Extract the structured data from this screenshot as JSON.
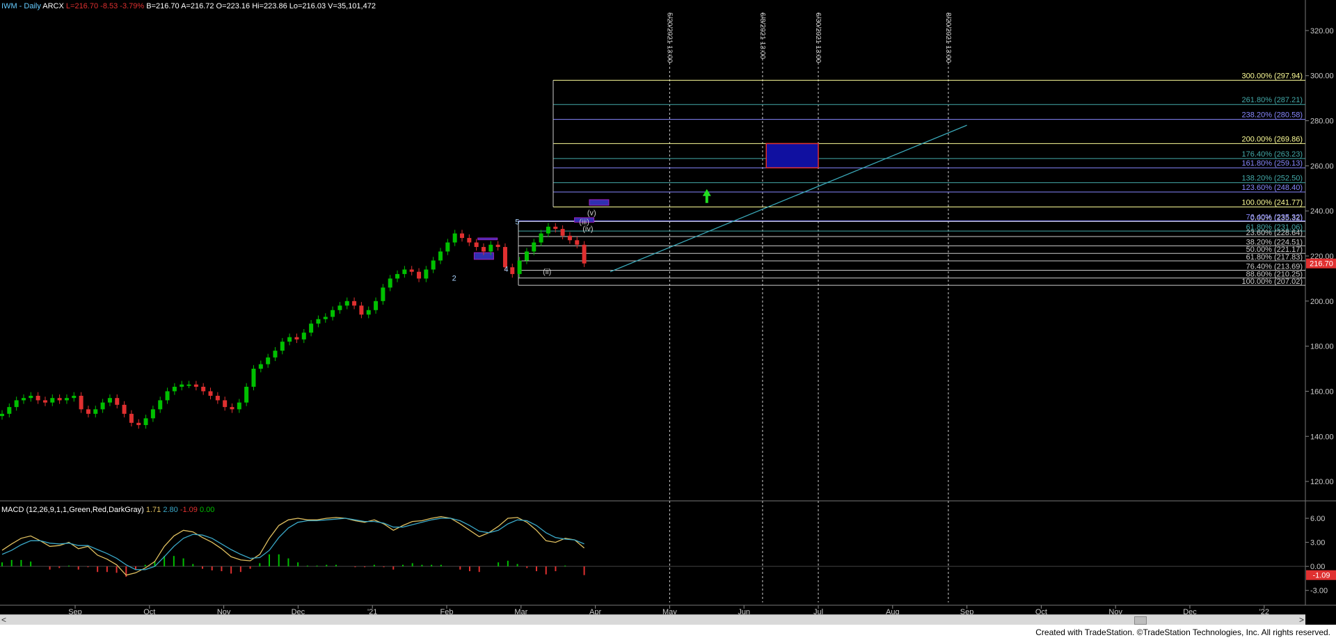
{
  "header": {
    "symbol": "IWM - Daily",
    "exchange": "ARCX",
    "last": "L=216.70",
    "change": "-8.53",
    "pct": "-3.79%",
    "bid": "B=216.70",
    "ask": "A=216.72",
    "open": "O=223.16",
    "high": "Hi=223.86",
    "low": "Lo=216.03",
    "volume": "V=35,101,472"
  },
  "macd_header": {
    "label": "MACD (12,26,9,1,1,Green,Red,DarkGray)",
    "v1": "1.71",
    "v2": "2.80",
    "v3": "-1.09",
    "v4": "0.00"
  },
  "colors": {
    "background": "#000000",
    "up_candle": "#00c000",
    "down_candle": "#e03030",
    "fib_yellow": "#ffff99",
    "fib_teal": "#44aaaa",
    "fib_blue": "#8888ff",
    "fib_white": "#cccccc",
    "target_box": "#1010a0",
    "trend_line": "#3aa8b8",
    "macd_line": "#3aa8c8",
    "signal_line": "#e0c060"
  },
  "footer": "Created with TradeStation. ©TradeStation Technologies, Inc. All rights reserved.",
  "chart_data": {
    "type": "candlestick",
    "price_axis": {
      "ylim": [
        112,
        328
      ],
      "ticks": [
        "320.00",
        "300.00",
        "280.00",
        "260.00",
        "240.00",
        "220.00",
        "200.00",
        "180.00",
        "160.00",
        "140.00",
        "120.00"
      ]
    },
    "current_price_label": "216.70",
    "macd_axis": {
      "ylim": [
        -4.5,
        8
      ],
      "ticks": [
        "6.00",
        "3.00",
        "0.00",
        "-3.00"
      ],
      "current_label": "-1.09"
    },
    "months": [
      "Sep",
      "Oct",
      "Nov",
      "Dec",
      "'21",
      "Feb",
      "Mar",
      "Apr",
      "May",
      "Jun",
      "Jul",
      "Aug",
      "Sep",
      "Oct",
      "Nov",
      "Dec",
      "'22"
    ],
    "close_path": [
      150,
      153,
      156,
      157,
      158,
      156,
      155,
      157,
      156,
      157,
      158,
      152,
      150,
      152,
      155,
      157,
      154,
      150,
      146,
      145,
      148,
      152,
      156,
      160,
      162,
      163,
      163,
      162,
      160,
      158,
      156,
      153,
      152,
      155,
      162,
      170,
      172,
      175,
      178,
      182,
      184,
      183,
      186,
      190,
      192,
      193,
      196,
      198,
      200,
      198,
      194,
      196,
      200,
      206,
      210,
      212,
      214,
      213,
      210,
      214,
      218,
      222,
      226,
      230,
      228,
      226,
      224,
      222,
      225,
      224,
      215,
      212,
      218,
      222,
      226,
      230,
      233,
      232,
      229,
      227,
      225,
      216.7
    ],
    "fib_levels_up": [
      {
        "label": "300.00% (297.94)",
        "value": 297.94,
        "color": "#ffff99"
      },
      {
        "label": "261.80% (287.21)",
        "value": 287.21,
        "color": "#44aaaa"
      },
      {
        "label": "238.20% (280.58)",
        "value": 280.58,
        "color": "#8888ff"
      },
      {
        "label": "200.00% (269.86)",
        "value": 269.86,
        "color": "#ffff99"
      },
      {
        "label": "176.40% (263.23)",
        "value": 263.23,
        "color": "#44aaaa"
      },
      {
        "label": "161.80% (259.13)",
        "value": 259.13,
        "color": "#8888ff"
      },
      {
        "label": "138.20% (252.50)",
        "value": 252.5,
        "color": "#44aaaa"
      },
      {
        "label": "123.60% (248.40)",
        "value": 248.4,
        "color": "#8888ff"
      },
      {
        "label": "100.00% (241.77)",
        "value": 241.77,
        "color": "#ffff99"
      }
    ],
    "fib_levels_retrace": [
      {
        "label": "0.00% (235.32)",
        "value": 235.32,
        "color": "#cccccc"
      },
      {
        "label": "76.40% (235.32)",
        "value": 235.6,
        "color": "#8888ff"
      },
      {
        "label": "61.80% (231.06)",
        "value": 231.06,
        "color": "#44aaaa"
      },
      {
        "label": "23.60% (228.64)",
        "value": 228.64,
        "color": "#cccccc"
      },
      {
        "label": "38.20% (224.51)",
        "value": 224.51,
        "color": "#cccccc"
      },
      {
        "label": "50.00% (221.17)",
        "value": 221.17,
        "color": "#cccccc"
      },
      {
        "label": "61.80% (217.83)",
        "value": 217.83,
        "color": "#cccccc"
      },
      {
        "label": "76.40% (213.69)",
        "value": 213.69,
        "color": "#cccccc"
      },
      {
        "label": "88.60% (210.25)",
        "value": 210.25,
        "color": "#cccccc"
      },
      {
        "label": "100.00% (207.02)",
        "value": 207.02,
        "color": "#cccccc"
      }
    ],
    "time_lines": [
      {
        "label": "5/20/2021 13:00",
        "month_pos": 8.0
      },
      {
        "label": "6/8/2021 13:00",
        "month_pos": 9.25
      },
      {
        "label": "6/30/2021 13:00",
        "month_pos": 10.0
      },
      {
        "label": "8/20/2021 13:00",
        "month_pos": 11.75
      }
    ],
    "target_box": {
      "month_from": 9.3,
      "month_to": 10.0,
      "low": 259.13,
      "high": 269.86
    },
    "trend_line": {
      "from": {
        "month_pos": 7.2,
        "value": 213
      },
      "to": {
        "month_pos": 12.0,
        "value": 278
      }
    },
    "wave_labels": [
      {
        "text": "2",
        "month_pos": 5.1,
        "value": 209
      },
      {
        "text": "4",
        "month_pos": 5.8,
        "value": 213
      },
      {
        "text": "5",
        "month_pos": 5.95,
        "value": 234
      },
      {
        "text": "(v)",
        "month_pos": 6.95,
        "value": 238
      },
      {
        "text": "(iii)",
        "month_pos": 6.85,
        "value": 234
      },
      {
        "text": "(iv)",
        "month_pos": 6.9,
        "value": 231
      },
      {
        "text": "(ii)",
        "month_pos": 6.35,
        "value": 212
      }
    ],
    "macd_series": {
      "macd": [
        2,
        2.8,
        3.5,
        3.8,
        3.2,
        2.5,
        2.6,
        3,
        2.2,
        2.5,
        1.4,
        0.9,
        0.2,
        -1.1,
        -0.8,
        -0.2,
        0.6,
        2.5,
        3.8,
        4.5,
        4.3,
        3.6,
        3,
        2.2,
        1.2,
        0.8,
        0.7,
        1.5,
        3.5,
        5.1,
        5.8,
        6,
        5.8,
        5.8,
        6,
        6.1,
        6,
        5.7,
        5.5,
        5.8,
        5.3,
        4.5,
        5.1,
        5.6,
        5.7,
        6,
        6.2,
        6,
        5.3,
        4.5,
        3.7,
        4.2,
        5,
        6,
        6.1,
        5.5,
        4.5,
        3.2,
        3,
        3.5,
        3.3,
        2.3
      ],
      "signal": [
        1.5,
        2,
        2.7,
        3.2,
        3.2,
        2.9,
        2.8,
        2.9,
        2.6,
        2.6,
        2.1,
        1.6,
        1,
        0.2,
        -0.4,
        -0.4,
        0,
        1.2,
        2.5,
        3.5,
        4,
        3.9,
        3.5,
        2.8,
        2.1,
        1.5,
        1,
        1.1,
        2,
        3.6,
        4.8,
        5.5,
        5.7,
        5.7,
        5.8,
        5.9,
        6,
        5.8,
        5.6,
        5.6,
        5.4,
        4.9,
        4.9,
        5.2,
        5.5,
        5.8,
        6,
        6,
        5.7,
        5.1,
        4.4,
        4.2,
        4.5,
        5.3,
        5.8,
        5.7,
        5.1,
        4.2,
        3.6,
        3.4,
        3.3,
        2.8
      ],
      "hist": [
        0.5,
        0.8,
        0.8,
        0.6,
        0,
        -0.4,
        -0.2,
        0.1,
        -0.4,
        -0.1,
        -0.7,
        -0.7,
        -0.8,
        -1.3,
        -0.4,
        0.2,
        0.6,
        1.3,
        1.3,
        1,
        0.3,
        -0.3,
        -0.5,
        -0.6,
        -0.9,
        -0.7,
        -0.3,
        0.4,
        1.5,
        1.5,
        1,
        0.5,
        0.1,
        0.1,
        0.2,
        0.2,
        0,
        -0.1,
        -0.1,
        0.2,
        -0.1,
        -0.4,
        0.2,
        0.4,
        0.2,
        0.2,
        0.2,
        0,
        -0.4,
        -0.6,
        -0.7,
        0,
        0.5,
        0.7,
        0.3,
        -0.2,
        -0.6,
        -1,
        -0.6,
        0.1,
        0,
        -1.09
      ]
    }
  }
}
